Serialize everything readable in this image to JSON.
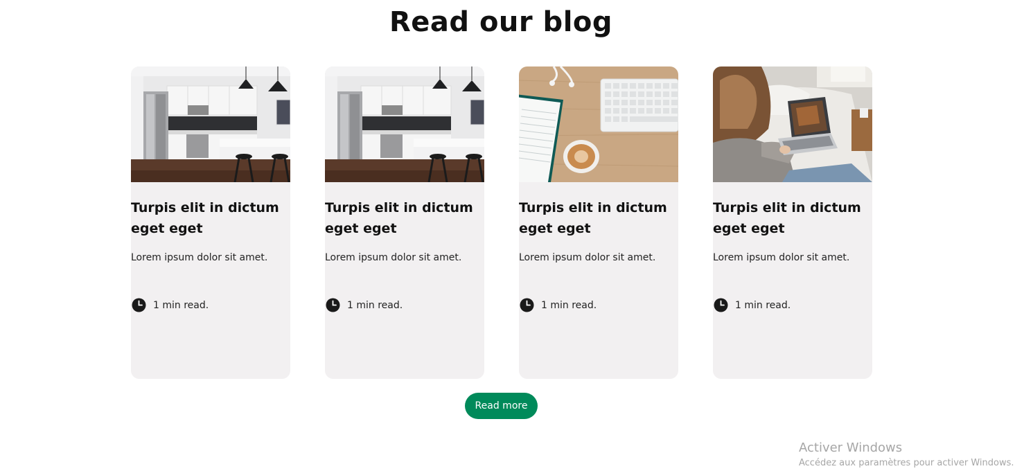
{
  "section": {
    "title": "Read our blog"
  },
  "cards": [
    {
      "image": "kitchen-photo",
      "title": "Turpis elit in dictum eget eget",
      "description": "Lorem ipsum dolor sit amet.",
      "read_time": "1 min read.",
      "icon": "clock-icon"
    },
    {
      "image": "kitchen-photo",
      "title": "Turpis elit in dictum eget eget",
      "description": "Lorem ipsum dolor sit amet.",
      "read_time": "1 min read.",
      "icon": "clock-icon"
    },
    {
      "image": "desk-coffee-keyboard-photo",
      "title": "Turpis elit in dictum eget eget",
      "description": "Lorem ipsum dolor sit amet.",
      "read_time": "1 min read.",
      "icon": "clock-icon"
    },
    {
      "image": "woman-laptop-bed-photo",
      "title": "Turpis elit in dictum eget eget",
      "description": "Lorem ipsum dolor sit amet.",
      "read_time": "1 min read.",
      "icon": "clock-icon"
    }
  ],
  "read_more_button": {
    "label": "Read more"
  },
  "os_watermark": {
    "title": "Activer Windows",
    "subtitle": "Accédez aux paramètres pour activer Windows."
  },
  "colors": {
    "card_background": "#f2f0f1",
    "button_background": "#008a5a",
    "button_text": "#ffffff",
    "watermark_text": "#a6a6a6"
  }
}
